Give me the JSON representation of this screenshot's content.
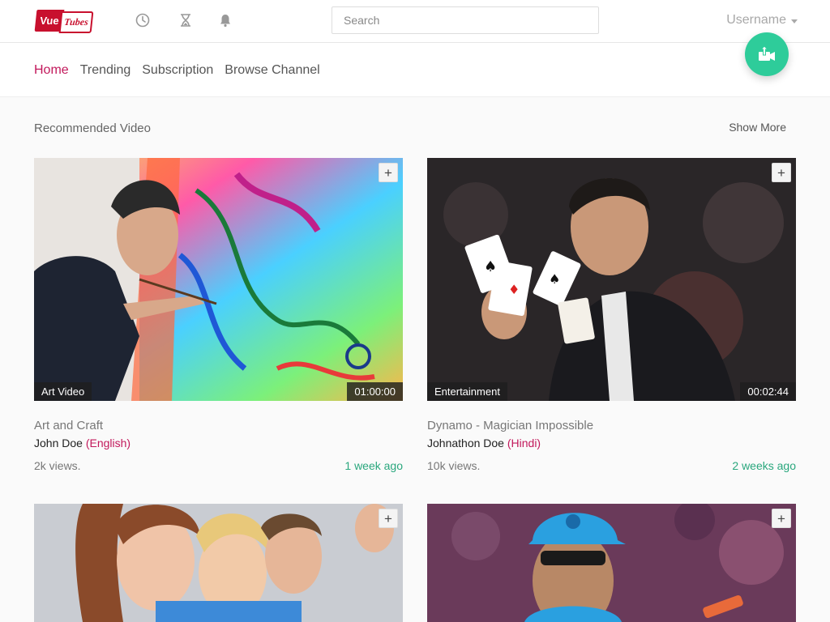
{
  "header": {
    "logo_vue": "Vue",
    "logo_tubes": "Tubes",
    "icons": [
      "clock-icon",
      "hourglass-icon",
      "bell-icon"
    ],
    "search_placeholder": "Search",
    "username": "Username"
  },
  "subnav": {
    "links": [
      "Home",
      "Trending",
      "Subscription",
      "Browse Channel"
    ],
    "active": "Home"
  },
  "section": {
    "title": "Recommended Video",
    "show_more": "Show More"
  },
  "videos": [
    {
      "category": "Art Video",
      "duration": "01:00:00",
      "title": "Art and Craft",
      "author": "John Doe",
      "language": "(English)",
      "views": "2k views.",
      "ago": "1 week ago"
    },
    {
      "category": "Entertainment",
      "duration": "00:02:44",
      "title": "Dynamo - Magician Impossible",
      "author": "Johnathon Doe",
      "language": "(Hindi)",
      "views": "10k views.",
      "ago": "2 weeks ago"
    },
    {
      "category": "",
      "duration": "",
      "title": "",
      "author": "",
      "language": "",
      "views": "",
      "ago": ""
    },
    {
      "category": "",
      "duration": "",
      "title": "",
      "author": "",
      "language": "",
      "views": "",
      "ago": ""
    }
  ],
  "colors": {
    "brand": "#c8102e",
    "active_link": "#c2185b",
    "fab": "#2ecc9a",
    "time_ago": "#2aa77d"
  }
}
